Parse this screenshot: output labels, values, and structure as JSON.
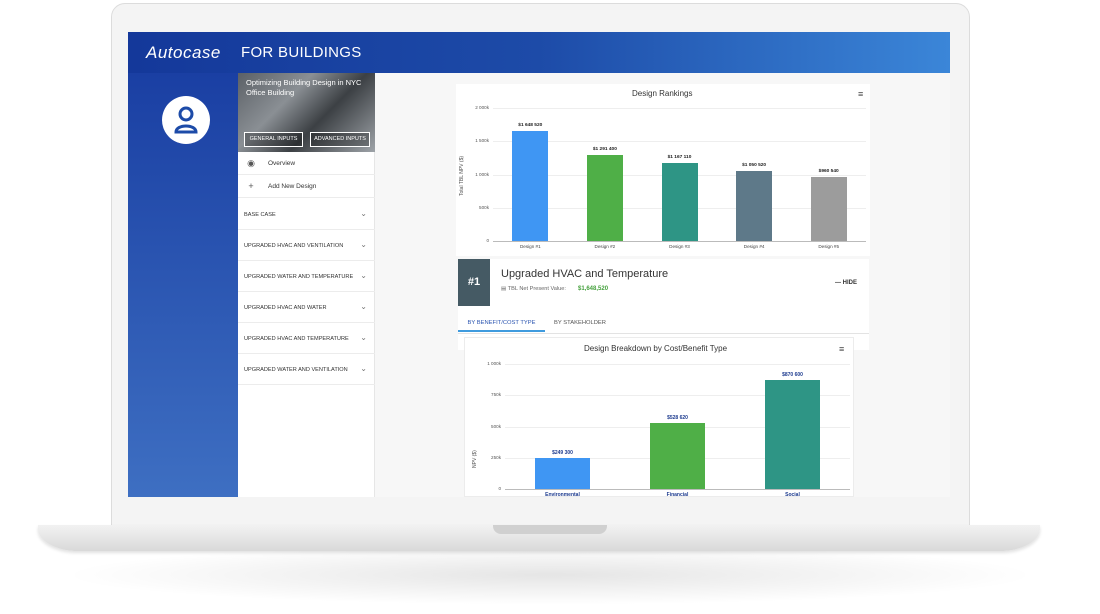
{
  "app": {
    "logo": "Autocase",
    "title": "FOR BUILDINGS"
  },
  "sidebar": {
    "hero_title": "Optimizing Building Design in NYC Office Building",
    "general_inputs": "GENERAL INPUTS",
    "advanced_inputs": "ADVANCED INPUTS",
    "overview": "Overview",
    "add_design": "Add New Design",
    "sections": [
      "BASE CASE",
      "UPGRADED HVAC AND VENTILATION",
      "UPGRADED WATER AND TEMPERATURE",
      "UPGRADED HVAC AND WATER",
      "UPGRADED HVAC AND TEMPERATURE",
      "UPGRADED WATER AND VENTILATION"
    ]
  },
  "rankings": {
    "menu": "≡",
    "chart_data": {
      "type": "bar",
      "title": "Design Rankings",
      "ylabel": "Total TBL NPV ($)",
      "ylim": [
        0,
        2000000
      ],
      "yticks": [
        "0",
        "500k",
        "1 000k",
        "1 500k",
        "2 000k"
      ],
      "categories": [
        "Design #1",
        "Design #2",
        "Design #3",
        "Design #4",
        "Design #5"
      ],
      "values": [
        1648520,
        1291400,
        1167110,
        1050520,
        960540
      ],
      "value_labels": [
        "$1 648 520",
        "$1 291 400",
        "$1 167 110",
        "$1 050 520",
        "$960 540"
      ],
      "colors": [
        "#3f96f3",
        "#4faf47",
        "#2e9585",
        "#5e7989",
        "#9c9c9c"
      ]
    }
  },
  "detail": {
    "rank": "#1",
    "title": "Upgraded HVAC and Temperature",
    "npv_label": "TBL Net Present Value:",
    "npv_value": "$1,648,520",
    "hide": "HIDE",
    "tabs": [
      "BY BENEFIT/COST TYPE",
      "BY STAKEHOLDER"
    ]
  },
  "breakdown": {
    "menu": "≡",
    "chart_data": {
      "type": "bar",
      "title": "Design Breakdown by Cost/Benefit Type",
      "ylabel": "NPV ($)",
      "ylim": [
        0,
        1000000
      ],
      "yticks": [
        "0",
        "250k",
        "500k",
        "750k",
        "1 000k"
      ],
      "categories": [
        "Environmental",
        "Financial",
        "Social"
      ],
      "values": [
        249300,
        528620,
        870600
      ],
      "value_labels": [
        "$249 300",
        "$528 620",
        "$870 600"
      ],
      "colors": [
        "#3f96f3",
        "#4faf47",
        "#2e9585"
      ]
    }
  }
}
